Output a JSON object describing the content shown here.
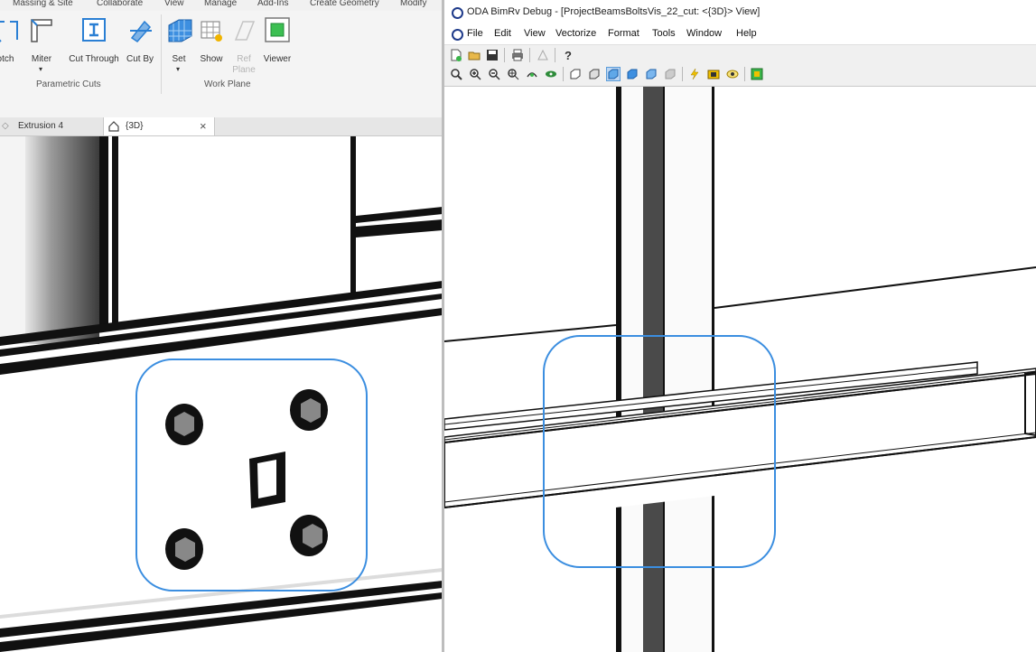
{
  "revit": {
    "ribbon_tabs": [
      "Massing & Site",
      "Collaborate",
      "View",
      "Manage",
      "Add-Ins",
      "Create Geometry",
      "Modify"
    ],
    "buttons": {
      "notch": "otch",
      "miter": "Miter",
      "cut_through": "Cut Through",
      "cut_by": "Cut By",
      "set": "Set",
      "show": "Show",
      "ref_plane_line1": "Ref",
      "ref_plane_line2": "Plane",
      "viewer": "Viewer"
    },
    "panels": {
      "parametric_cuts": "Parametric Cuts",
      "work_plane": "Work Plane"
    },
    "doc_tabs": {
      "extrusion": "Extrusion 4",
      "view3d": "{3D}",
      "close": "×"
    }
  },
  "oda": {
    "title": "ODA BimRv Debug - [ProjectBeamsBoltsVis_22_cut: <{3D}> View]",
    "menu": [
      "File",
      "Edit",
      "View",
      "Vectorize",
      "Format",
      "Tools",
      "Window",
      "Help"
    ]
  },
  "colors": {
    "highlight": "#3b8ee0",
    "toolbar_bg": "#f0f0f0",
    "ribbon_bg": "#f4f4f4"
  }
}
